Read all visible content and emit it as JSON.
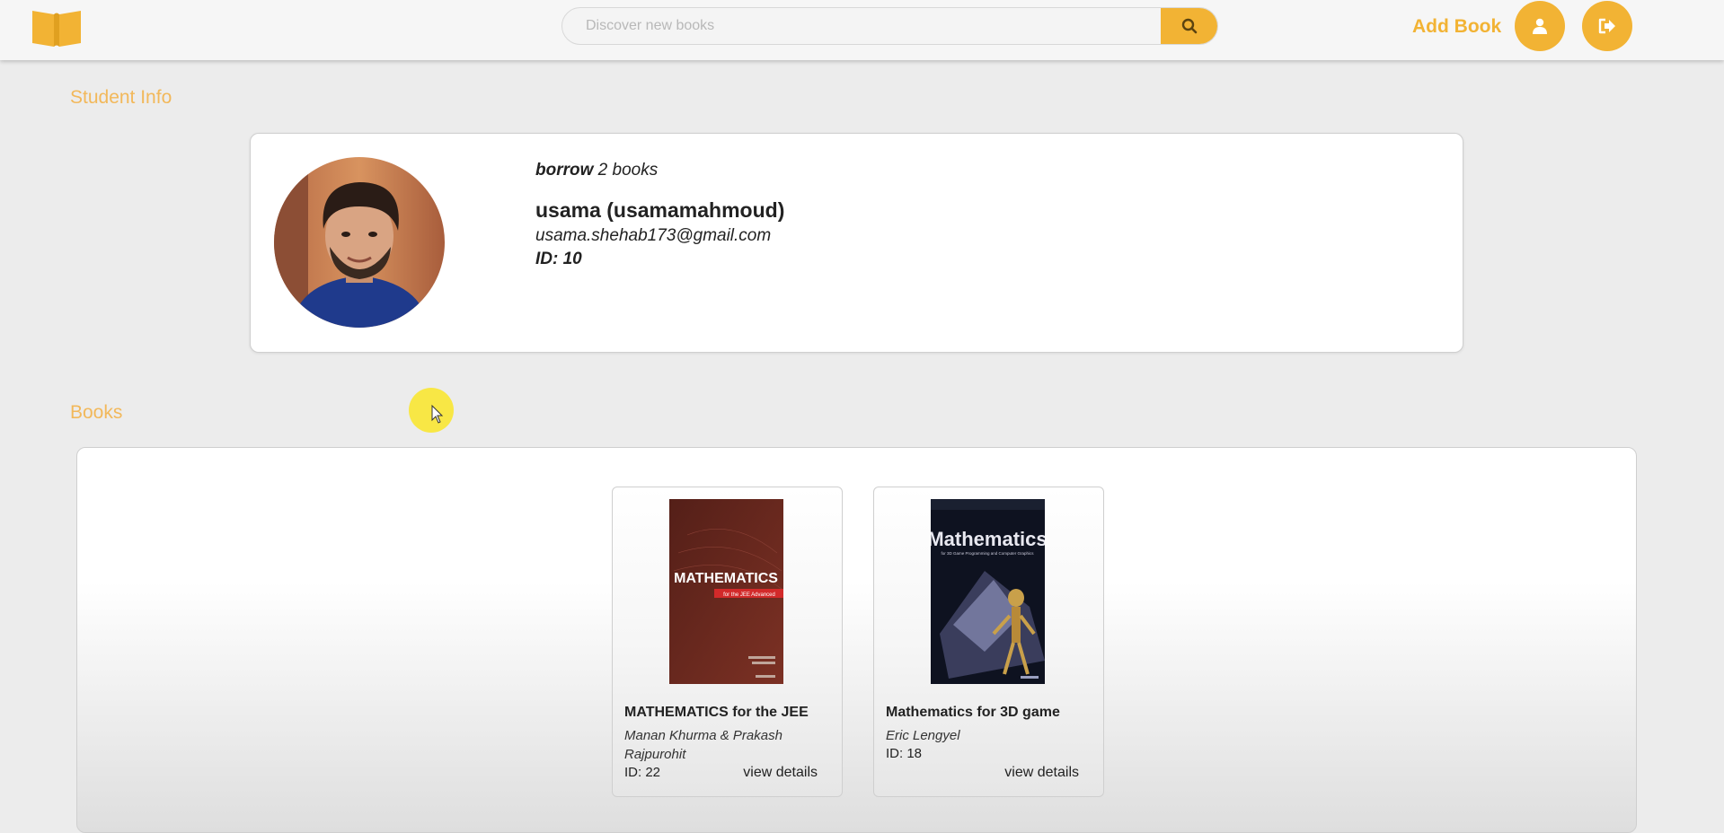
{
  "header": {
    "search_placeholder": "Discover new books",
    "add_book_label": "Add Book"
  },
  "student_section": {
    "title": "Student Info",
    "borrow_word": "borrow",
    "borrow_count": "2 books",
    "name": "usama (usamamahmoud)",
    "email": "usama.shehab173@gmail.com",
    "id": "ID: 10"
  },
  "books_section": {
    "title": "Books",
    "books": [
      {
        "title": "MATHEMATICS for the JEE",
        "author": "Manan Khurma & Prakash Rajpurohit",
        "id": "ID: 22",
        "action": "view details",
        "cover_text": "MATHEMATICS",
        "cover_subtitle": "for the JEE Advanced"
      },
      {
        "title": "Mathematics for 3D game",
        "author": "Eric Lengyel",
        "id": "ID: 18",
        "action": "view details",
        "cover_text": "Mathematics",
        "cover_subtitle": "for 3D Game Programming and Computer Graphics"
      }
    ]
  },
  "colors": {
    "accent": "#f2b334",
    "section_title": "#f2b85a",
    "background": "#ececec"
  },
  "icons": [
    "book-logo-icon",
    "search-icon",
    "user-icon",
    "logout-icon"
  ]
}
